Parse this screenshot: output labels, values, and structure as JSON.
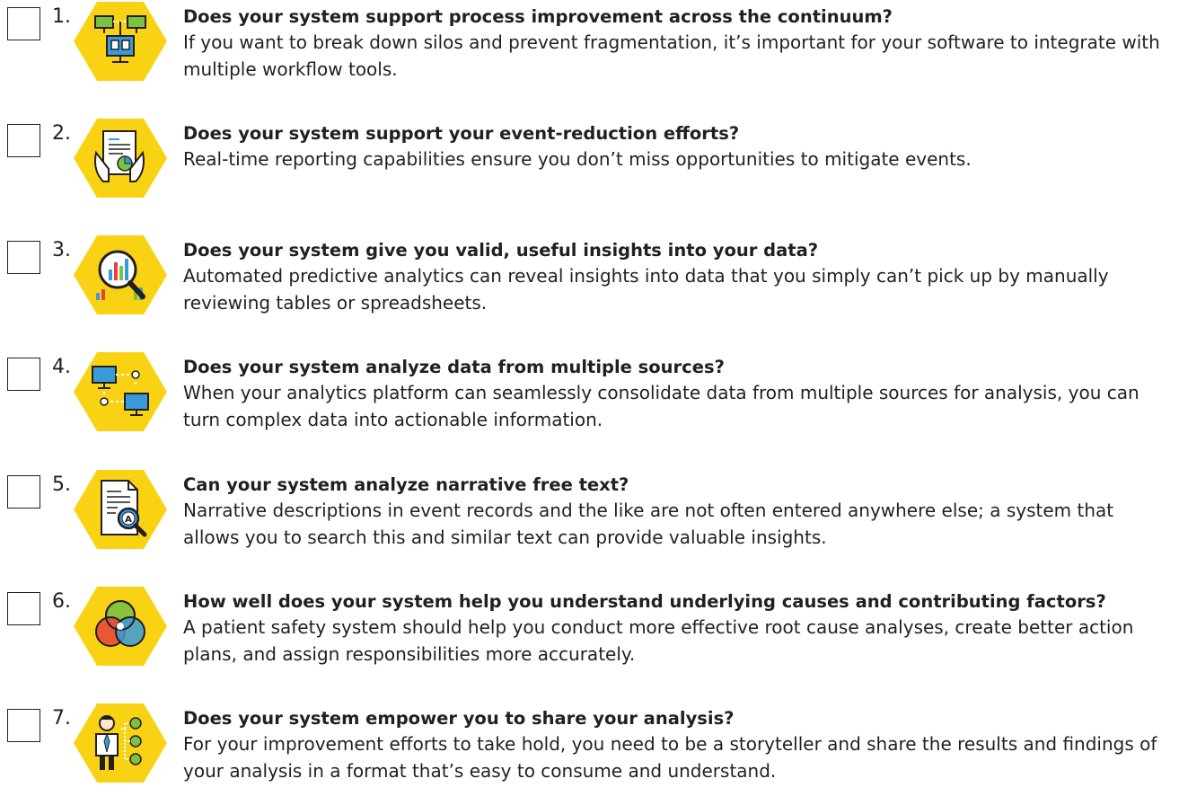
{
  "items": [
    {
      "number": "1.",
      "question": "Does your system support process improvement across the continuum?",
      "description": "If you want to break down silos and prevent fragmentation, it’s important for your software to integrate with multiple workflow tools.",
      "icon": "connected-computers-icon"
    },
    {
      "number": "2.",
      "question": "Does your system support your event-reduction efforts?",
      "description": "Real-time reporting capabilities ensure you don’t miss opportunities to mitigate events.",
      "icon": "report-in-hands-icon"
    },
    {
      "number": "3.",
      "question": "Does your system give you valid, useful insights into your data?",
      "description": "Automated predictive analytics can reveal insights into data that you simply can’t pick up by manually reviewing tables or spreadsheets.",
      "icon": "magnifier-chart-icon"
    },
    {
      "number": "4.",
      "question": "Does your system analyze data from multiple sources?",
      "description": "When your analytics platform can seamlessly consolidate data from multiple sources for analysis, you can turn complex data into actionable information.",
      "icon": "linked-monitors-icon"
    },
    {
      "number": "5.",
      "question": "Can your system analyze narrative free text?",
      "description": "Narrative descriptions in event records and the like are not often entered anywhere else; a system that allows you to search this and similar text can provide valuable insights.",
      "icon": "document-search-icon"
    },
    {
      "number": "6.",
      "question": "How well does your system help you understand underlying causes and contributing factors?",
      "description": "A patient safety system should help you conduct more effective root cause analyses, create better action plans, and assign responsibilities more accurately.",
      "icon": "venn-diagram-icon"
    },
    {
      "number": "7.",
      "question": "Does your system empower you to share your analysis?",
      "description": "For your improvement efforts to take hold, you need to be a storyteller and share the results and findings of your analysis in a format that’s easy to consume and understand.",
      "icon": "person-network-icon"
    }
  ],
  "colors": {
    "hexagon": "#f9d313",
    "text": "#231f20",
    "icon_blue": "#3a9ad9",
    "icon_green": "#7cc142",
    "icon_red": "#e8413c"
  }
}
